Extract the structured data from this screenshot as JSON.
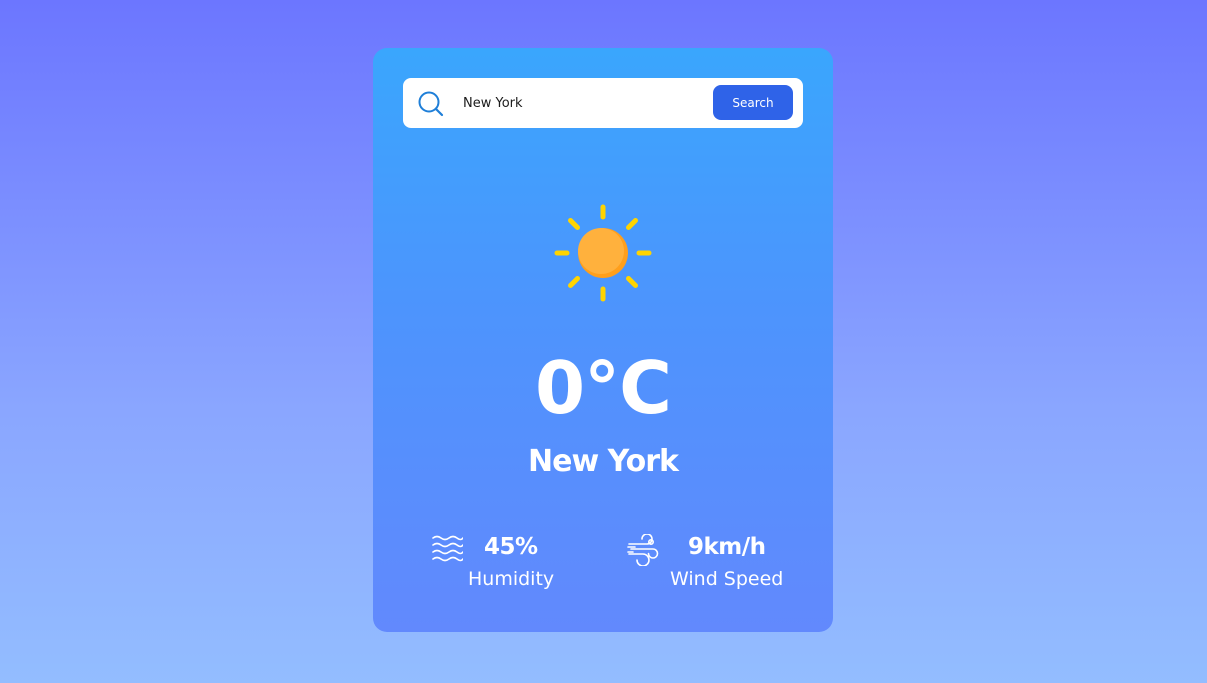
{
  "search": {
    "value": "New York",
    "button_label": "Search",
    "icon": "search-icon"
  },
  "weather": {
    "condition_icon": "sun-icon",
    "temperature": "0°C",
    "city": "New York"
  },
  "details": {
    "humidity": {
      "icon": "humidity-waves-icon",
      "value": "45%",
      "label": "Humidity"
    },
    "wind": {
      "icon": "wind-icon",
      "value": "9km/h",
      "label": "Wind Speed"
    }
  },
  "colors": {
    "accent": "#2f63e8",
    "sun_core": "#ffb13d",
    "sun_rays": "#ffd400"
  }
}
